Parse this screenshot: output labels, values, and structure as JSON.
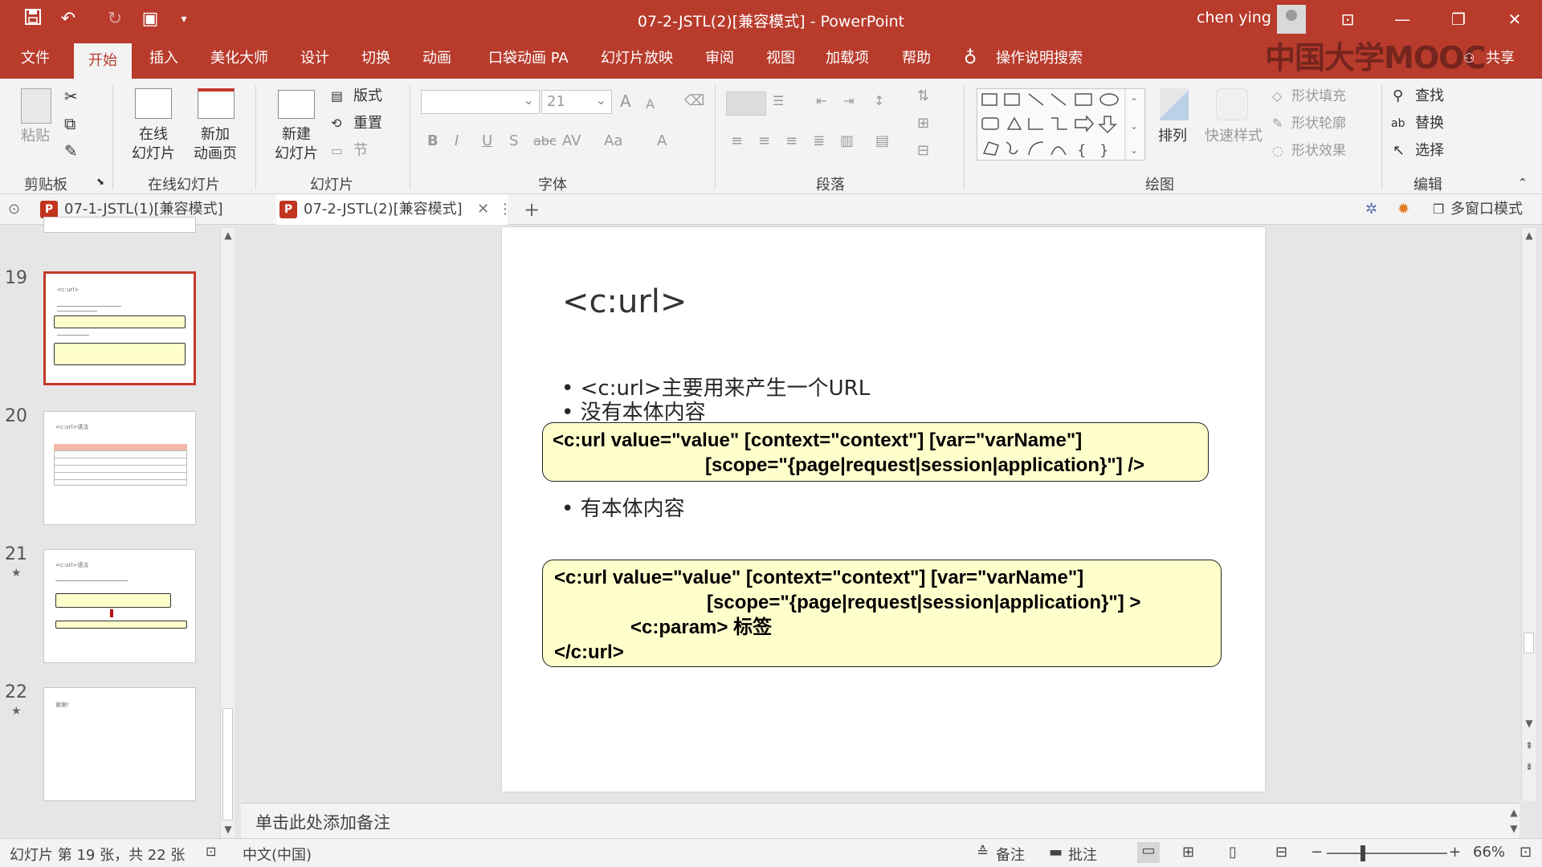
{
  "titlebar": {
    "doc_title": "07-2-JSTL(2)[兼容模式]  -  PowerPoint",
    "user_name": "chen ying",
    "qa_icons": [
      "save-icon",
      "undo-icon",
      "redo-icon",
      "present-icon",
      "customize-icon"
    ]
  },
  "ribbon_tabs": [
    "文件",
    "开始",
    "插入",
    "美化大师",
    "设计",
    "切换",
    "动画",
    "口袋动画 PA",
    "幻灯片放映",
    "审阅",
    "视图",
    "加载项",
    "帮助"
  ],
  "active_tab": "开始",
  "search_label": "操作说明搜索",
  "share_label": "共享",
  "watermark": "中国大学MOOC",
  "ribbon": {
    "clipboard": {
      "paste": "粘贴",
      "label": "剪贴板"
    },
    "online_slides": {
      "btn1_line1": "在线",
      "btn1_line2": "幻灯片",
      "btn2_line1": "新加",
      "btn2_line2": "动画页",
      "label": "在线幻灯片"
    },
    "slides": {
      "new_line1": "新建",
      "new_line2": "幻灯片",
      "layout": "版式",
      "reset": "重置",
      "section": "节",
      "label": "幻灯片"
    },
    "font": {
      "font_name": "",
      "font_size": "21",
      "bold": "B",
      "italic": "I",
      "underline": "U",
      "shadow": "S",
      "strike": "abc",
      "spacing": "AV",
      "case": "Aa",
      "color": "A",
      "grow": "A",
      "shrink": "A",
      "label": "字体"
    },
    "paragraph": {
      "label": "段落"
    },
    "drawing": {
      "arrange": "排列",
      "quick_styles": "快速样式",
      "fill": "形状填充",
      "outline": "形状轮廓",
      "effects": "形状效果",
      "label": "绘图"
    },
    "editing": {
      "find": "查找",
      "replace": "替换",
      "select": "选择",
      "label": "编辑"
    }
  },
  "doc_tabs": [
    {
      "title": "07-1-JSTL(1)[兼容模式]",
      "active": false
    },
    {
      "title": "07-2-JSTL(2)[兼容模式]",
      "active": true
    }
  ],
  "multi_window": "多窗口模式",
  "thumbnails": [
    {
      "num": "19",
      "title": "<c:url>",
      "selected": true
    },
    {
      "num": "20",
      "title": "<c:url>语法",
      "selected": false
    },
    {
      "num": "21",
      "title": "<c:url>语法",
      "selected": false
    },
    {
      "num": "22",
      "title": "谢谢!",
      "selected": false
    }
  ],
  "slide": {
    "title": "<c:url>",
    "bullet1": "<c:url>主要用来产生一个URL",
    "bullet2": "没有本体内容",
    "code1_line1": "<c:url value=\"value\" [context=\"context\"] [var=\"varName\"]",
    "code1_line2": "[scope=\"{page|request|session|application}\"] />",
    "bullet3": "有本体内容",
    "code2_line1": "<c:url value=\"value\" [context=\"context\"] [var=\"varName\"]",
    "code2_line2": "[scope=\"{page|request|session|application}\"] >",
    "code2_line3": "<c:param> 标签",
    "code2_line4": "</c:url>"
  },
  "notes_placeholder": "单击此处添加备注",
  "status": {
    "slide_info": "幻灯片 第 19 张，共 22 张",
    "language": "中文(中国)",
    "notes": "备注",
    "comments": "批注",
    "zoom": "66%"
  },
  "colors": {
    "accent": "#b83b2c",
    "codebox_fill": "#ffffcc",
    "selection": "#c5392a"
  }
}
